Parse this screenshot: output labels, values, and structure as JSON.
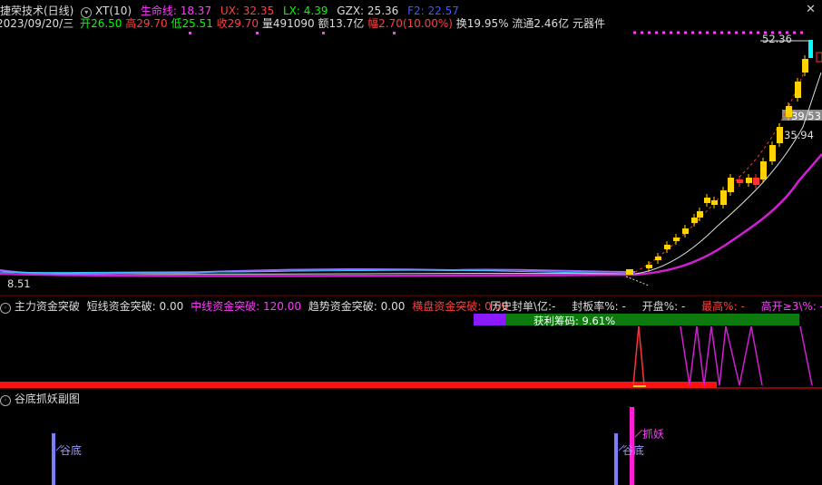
{
  "header": {
    "title": "捷荣技术(日线)",
    "dropdown": "XT(10)",
    "indicators": [
      {
        "label": "生命线:",
        "value": "18.37",
        "color": "#ff3bff"
      },
      {
        "label": "UX:",
        "value": "32.35",
        "color": "#ff4040"
      },
      {
        "label": "LX:",
        "value": "4.39",
        "color": "#00ff00"
      },
      {
        "label": "GZX:",
        "value": "25.36",
        "color": "#dddddd"
      },
      {
        "label": "F2:",
        "value": "22.57",
        "color": "#3a5bff"
      }
    ],
    "close_button": "✕"
  },
  "quote": {
    "date": "2023/09/20/三",
    "open_label": "开",
    "open": "26.50",
    "high_label": "高",
    "high": "29.70",
    "low_label": "低",
    "low": "25.51",
    "close_label": "收",
    "close": "29.70",
    "volume_label": "量",
    "volume": "491090",
    "amount_label": "额",
    "amount": "13.7亿",
    "change_label": "幅",
    "change": "2.70(10.00%)",
    "turnover_label": "换",
    "turnover": "19.95%",
    "float_label": "流通",
    "float": "2.46亿",
    "sector": "元器件"
  },
  "price_labels": {
    "high": "52.36",
    "mid": "39.53",
    "mid2": "35.94",
    "low": "8.51"
  },
  "panel2": {
    "title": "主力资金突破",
    "fields": [
      {
        "label": "短线资金突破:",
        "value": "0.00",
        "color": "#dddddd"
      },
      {
        "label": "中线资金突破:",
        "value": "120.00",
        "color": "#ff3bff"
      },
      {
        "label": "趋势资金突破:",
        "value": "0.00",
        "color": "#dddddd"
      },
      {
        "label": "横盘资金突破:",
        "value": "0.00",
        "color": "#ff4040"
      }
    ],
    "stats": [
      {
        "label": "历史封单\\亿:",
        "value": "-",
        "color": "#dddddd"
      },
      {
        "label": "封板率%:",
        "value": "-",
        "color": "#dddddd"
      },
      {
        "label": "开盘%:",
        "value": "-",
        "color": "#dddddd"
      },
      {
        "label": "最高%:",
        "value": "-",
        "color": "#ff4040"
      },
      {
        "label": "高开≥3\\%:",
        "value": "-",
        "color": "#ff3bff"
      }
    ],
    "profit_label": "获利筹码:",
    "profit_value": "9.61%",
    "profit_fraction": 0.9611
  },
  "panel3": {
    "title": "谷底抓妖副图",
    "markers": [
      "谷底",
      "谷底",
      "抓妖"
    ]
  },
  "colors": {
    "up": "#ff3333",
    "down": "#00ffff",
    "candle_yellow": "#ffd200",
    "life_line": "#d21ed2",
    "dotted_magenta": "#ff3bff"
  },
  "icons": [
    "circle-settings-icon",
    "dropdown-icon",
    "close-icon"
  ]
}
